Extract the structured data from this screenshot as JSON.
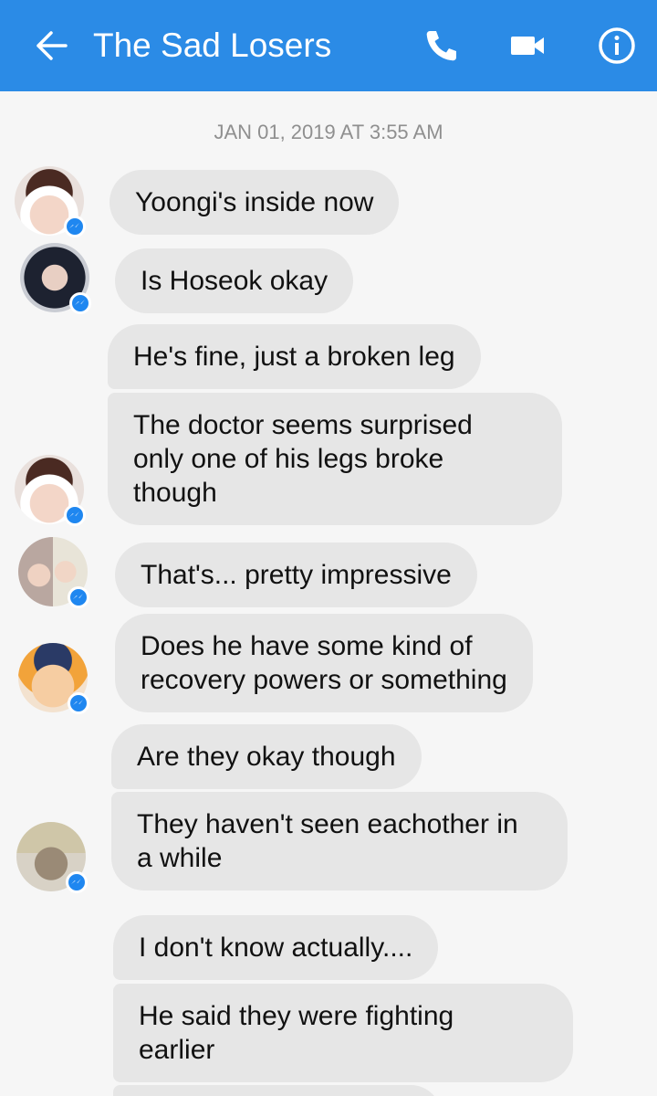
{
  "header": {
    "title": "The Sad Losers",
    "icons": [
      "back-arrow-icon",
      "phone-icon",
      "video-camera-icon",
      "info-icon"
    ],
    "color": "#2b8be6"
  },
  "timestamp": "JAN 01, 2019 AT 3:55 AM",
  "messages": [
    {
      "lines": [
        "Yoongi's inside now"
      ]
    },
    {
      "lines": [
        "Is Hoseok okay"
      ]
    },
    {
      "lines": [
        "He's fine, just a broken leg"
      ]
    },
    {
      "lines": [
        "The doctor seems surprised",
        "only one of his legs broke",
        "though"
      ]
    },
    {
      "lines": [
        "That's... pretty impressive"
      ]
    },
    {
      "lines": [
        "Does he have some kind of",
        "recovery powers or something"
      ]
    },
    {
      "lines": [
        "Are they okay though"
      ]
    },
    {
      "lines": [
        "They haven't seen eachother in",
        "a while"
      ]
    },
    {
      "lines": [
        "I don't know actually...."
      ]
    },
    {
      "lines": [
        "He said they were fighting",
        "earlier"
      ]
    }
  ],
  "colors": {
    "bubble": "#e6e6e6",
    "messenger_badge": "#1f87f0",
    "background": "#f6f6f6"
  }
}
